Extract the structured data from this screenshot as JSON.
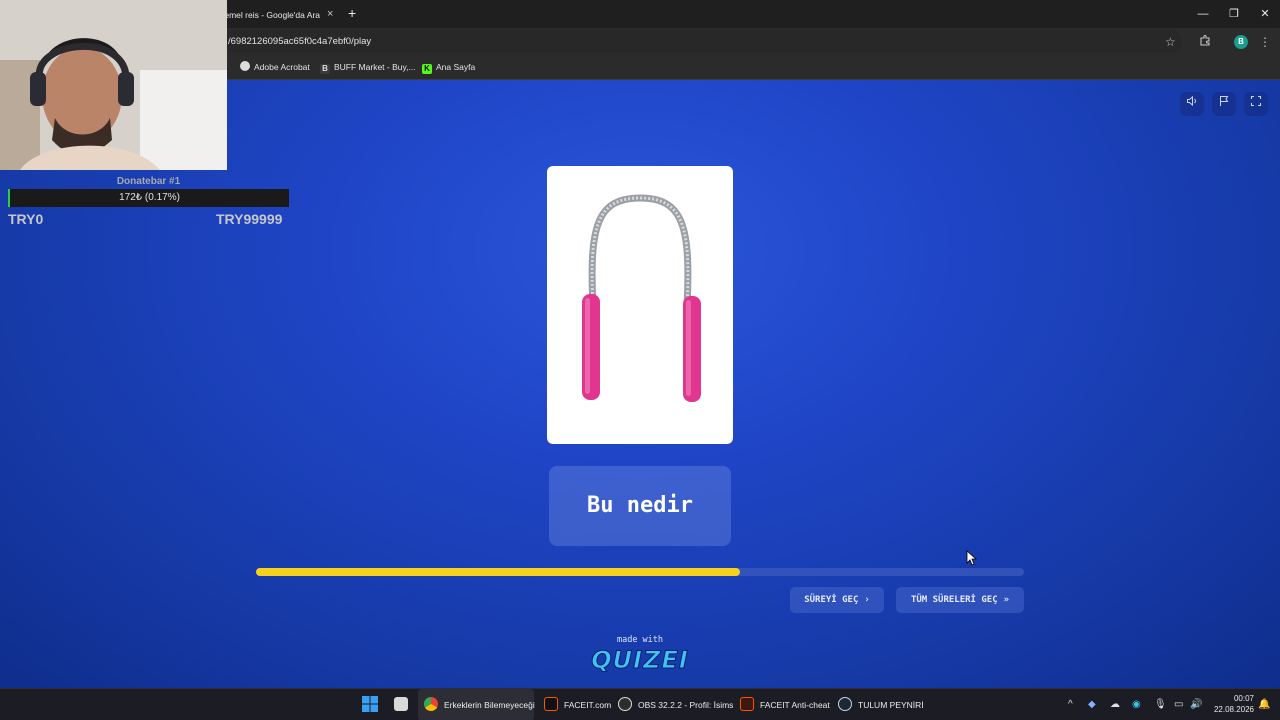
{
  "browser": {
    "tab_title": "temel reis - Google'da Ara",
    "tab_close": "×",
    "new_tab": "+",
    "url": "/6982126095ac65f0c4a7ebf0/play",
    "profile_initial": "B",
    "window_controls": {
      "minimize": "—",
      "restore": "❐",
      "close": "✕"
    },
    "bookmarks": [
      {
        "label": "Adobe Acrobat",
        "icon": "acrobat-icon"
      },
      {
        "label": "BUFF Market - Buy,...",
        "icon": "buff-icon"
      },
      {
        "label": "Ana Sayfa",
        "icon": "kick-icon"
      }
    ]
  },
  "overlay": {
    "donatebar_title": "Donatebar #1",
    "donatebar_value": "172₺ (0.17%)",
    "donatebar_min": "TRY0",
    "donatebar_max": "TRY99999",
    "donatebar_progress_percent": 0.17
  },
  "quiz": {
    "question": "Bu nedir",
    "progress_fraction": 0.63,
    "skip_label": "SÜREYİ GEÇ",
    "skip_arrow": "›",
    "skip_all_label": "TÜM SÜRELERİ GEÇ",
    "skip_all_arrow": "»",
    "made_with": "made with",
    "brand": "QUIZEI",
    "colors": {
      "progress": "#f7d21c",
      "background": "#1f45c6",
      "brand": "#3fc3f0"
    }
  },
  "taskbar": {
    "apps": [
      {
        "label": "Erkeklerin Bilemeyeceği",
        "icon": "chrome-icon"
      },
      {
        "label": "FACEIT.com",
        "icon": "faceit-icon"
      },
      {
        "label": "OBS 32.2.2 - Profil: İsims",
        "icon": "obs-icon"
      },
      {
        "label": "FACEIT Anti-cheat",
        "icon": "faceit-ac-icon"
      },
      {
        "label": "TULUM PEYNİRİ",
        "icon": "steam-icon"
      }
    ],
    "time": "00:07",
    "date": "22.08.2026"
  }
}
